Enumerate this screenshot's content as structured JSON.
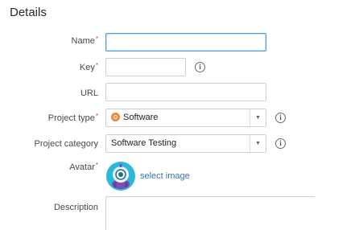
{
  "section_title": "Details",
  "fields": {
    "name": {
      "label": "Name",
      "value": "",
      "required": "*"
    },
    "key": {
      "label": "Key",
      "value": "",
      "required": "*"
    },
    "url": {
      "label": "URL",
      "value": ""
    },
    "project_type": {
      "label": "Project type",
      "value": "Software",
      "required": "*"
    },
    "project_category": {
      "label": "Project category",
      "value": "Software Testing"
    },
    "avatar": {
      "label": "Avatar",
      "link": "select image",
      "required": "*"
    },
    "description": {
      "label": "Description",
      "value": ""
    }
  },
  "icons": {
    "info": "i",
    "dropdown": "▼"
  },
  "colors": {
    "required": "#d04437",
    "focus_border": "#4a9ae1",
    "link": "#3b73af",
    "software_badge": "#f0883a",
    "avatar_bg": "#2cb8d8"
  }
}
